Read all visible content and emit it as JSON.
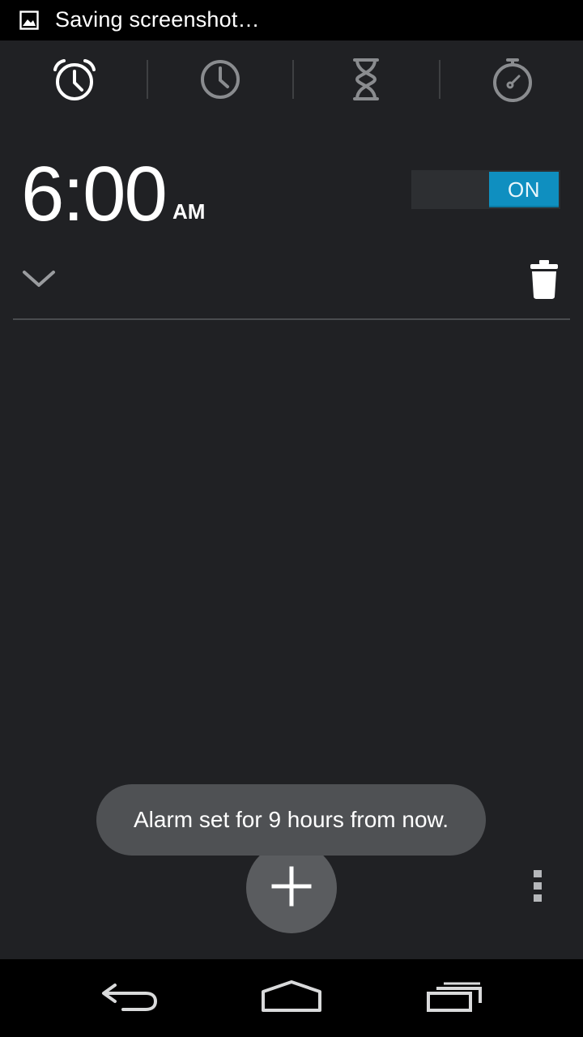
{
  "status_bar": {
    "notification_icon": "image-icon",
    "text": "Saving screenshot…"
  },
  "tabs": [
    {
      "name": "alarm",
      "icon": "alarm-clock-icon",
      "selected": true
    },
    {
      "name": "clock",
      "icon": "clock-icon",
      "selected": false
    },
    {
      "name": "timer",
      "icon": "hourglass-icon",
      "selected": false
    },
    {
      "name": "stopwatch",
      "icon": "stopwatch-icon",
      "selected": false
    }
  ],
  "alarm": {
    "time": "6:00",
    "ampm": "AM",
    "toggle_label": "ON",
    "enabled": true
  },
  "toast": {
    "message": "Alarm set for 9 hours from now."
  },
  "icons": {
    "expand": "chevron-down-icon",
    "delete": "trash-icon",
    "add": "plus-icon",
    "overflow": "more-vert-icon"
  },
  "nav": {
    "back": "back-icon",
    "home": "home-icon",
    "recents": "recents-icon"
  },
  "colors": {
    "background": "#202124",
    "accent": "#0f8fc0",
    "toast": "#4f5154",
    "fab": "#5a5c5f"
  }
}
